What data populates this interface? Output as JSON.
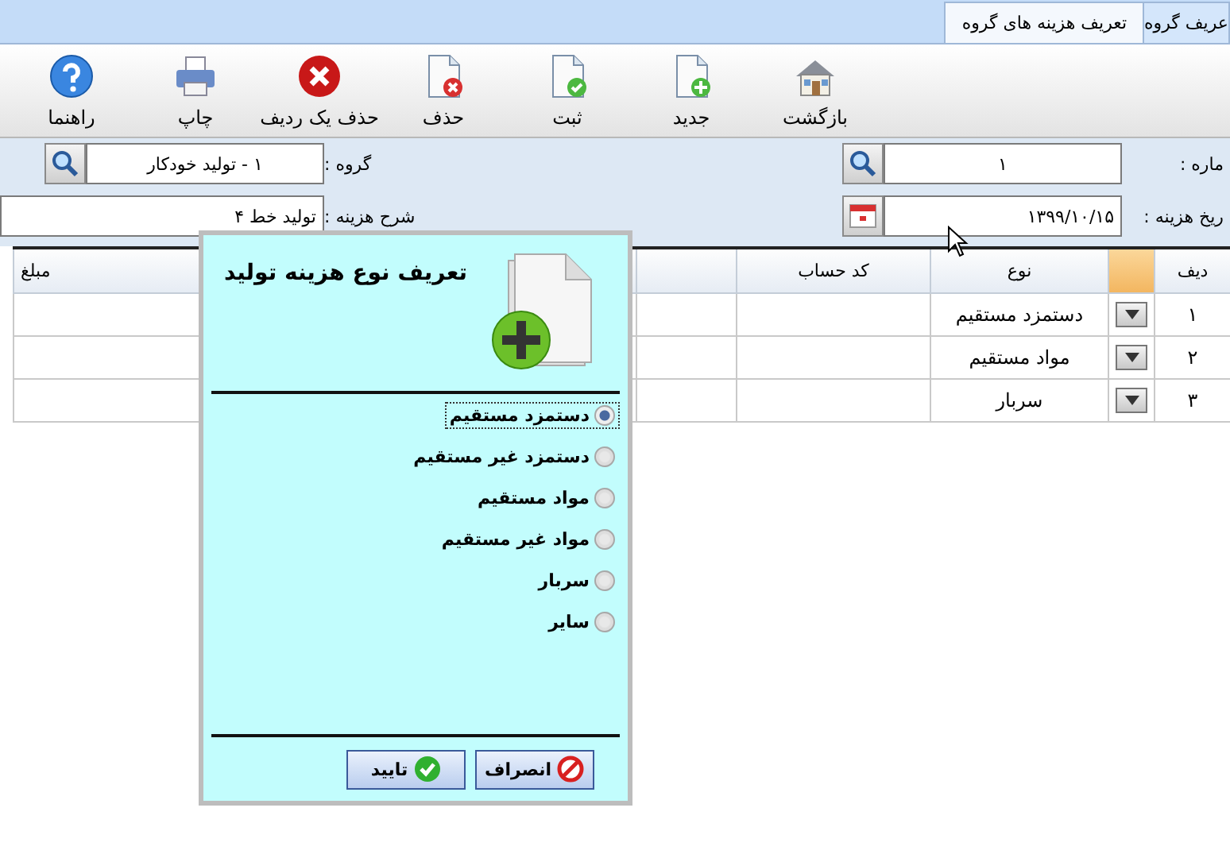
{
  "tabs": [
    {
      "label": "عریف گروه",
      "selected": false
    },
    {
      "label": "تعریف هزینه های گروه",
      "selected": true
    }
  ],
  "toolbar": [
    {
      "label": "بازگشت",
      "kind": "home"
    },
    {
      "label": "جدید",
      "kind": "new"
    },
    {
      "label": "ثبت",
      "kind": "save"
    },
    {
      "label": "حذف",
      "kind": "delete"
    },
    {
      "label": "حذف یک ردیف",
      "kind": "remove"
    },
    {
      "label": "چاپ",
      "kind": "print"
    },
    {
      "label": "راهنما",
      "kind": "help"
    }
  ],
  "form": {
    "number": {
      "label": "ماره :",
      "value": "۱"
    },
    "group": {
      "label": "گروه :",
      "value": "۱ - تولید خودکار"
    },
    "date": {
      "label": "ریخ هزینه :",
      "value": "۱۳۹۹/۱۰/۱۵"
    },
    "description": {
      "label": "شرح هزینه :",
      "value": "تولید خط ۴"
    }
  },
  "table": {
    "columns": [
      "دیف",
      "نوع",
      "کد حساب",
      "مبلغ"
    ],
    "rows": [
      {
        "number": "۱",
        "type": "دستمزد مستقیم"
      },
      {
        "number": "۲",
        "type": "مواد مستقیم"
      },
      {
        "number": "۳",
        "type": "سربار"
      }
    ]
  },
  "dialog": {
    "title": "تعریف نوع هزینه تولید",
    "options": [
      {
        "label": "دستمزد مستقیم",
        "selected": true
      },
      {
        "label": "دستمزد غیر مستقیم",
        "selected": false
      },
      {
        "label": "مواد مستقیم",
        "selected": false
      },
      {
        "label": "مواد غیر مستقیم",
        "selected": false
      },
      {
        "label": "سربار",
        "selected": false
      },
      {
        "label": "سایر",
        "selected": false
      }
    ],
    "buttons": [
      {
        "label": "انصراف",
        "kind": "cancel"
      },
      {
        "label": "تایید",
        "kind": "ok"
      }
    ]
  }
}
